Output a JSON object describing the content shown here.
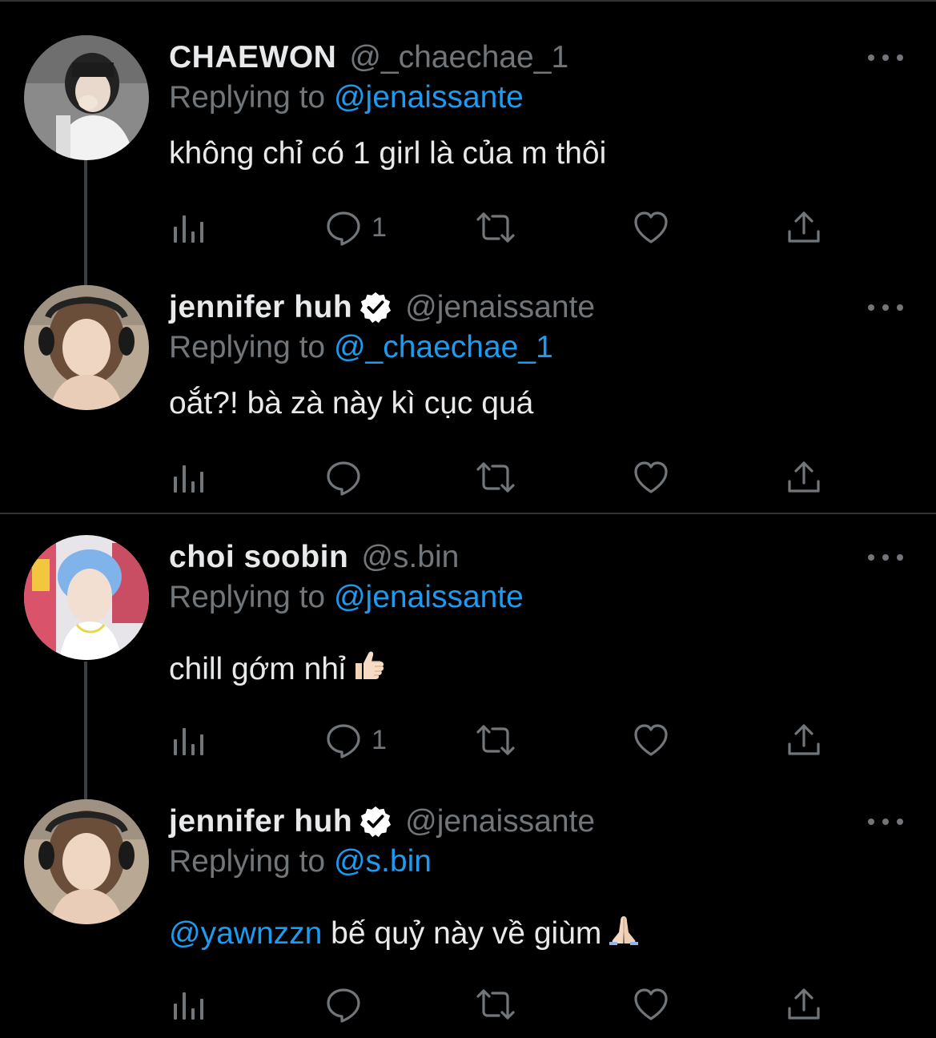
{
  "theme": {
    "background": "#000000",
    "text_primary": "#e7e9ea",
    "text_secondary": "#71767b",
    "accent": "#1d9bf0",
    "divider": "#2f3336"
  },
  "reply_prefix": "Replying to",
  "tweets": [
    {
      "display_name": "CHAEWON",
      "handle": "@_chaechae_1",
      "verified": false,
      "replying_to": "@jenaissante",
      "text": "không chỉ có 1 girl là của m thôi",
      "reply_count": "1",
      "avatar_icon": "avatar-photo"
    },
    {
      "display_name": "jennifer huh",
      "handle": "@jenaissante",
      "verified": true,
      "replying_to": "@_chaechae_1",
      "text": "oắt?! bà zà này kì cục quá",
      "reply_count": "",
      "avatar_icon": "avatar-photo"
    },
    {
      "display_name": "choi soobin",
      "handle": "@s.bin",
      "verified": false,
      "replying_to": "@jenaissante",
      "text": "chill gớm nhỉ",
      "text_emoji": "thumbs-up-emoji",
      "reply_count": "1",
      "avatar_icon": "avatar-photo"
    },
    {
      "display_name": "jennifer huh",
      "handle": "@jenaissante",
      "verified": true,
      "replying_to": "@s.bin",
      "text_mention": "@yawnzzn",
      "text": " bế quỷ này về giùm",
      "text_emoji": "folded-hands-emoji",
      "reply_count": "",
      "avatar_icon": "avatar-photo"
    }
  ],
  "action_icons": [
    "analytics-icon",
    "reply-icon",
    "retweet-icon",
    "like-icon",
    "share-icon"
  ]
}
